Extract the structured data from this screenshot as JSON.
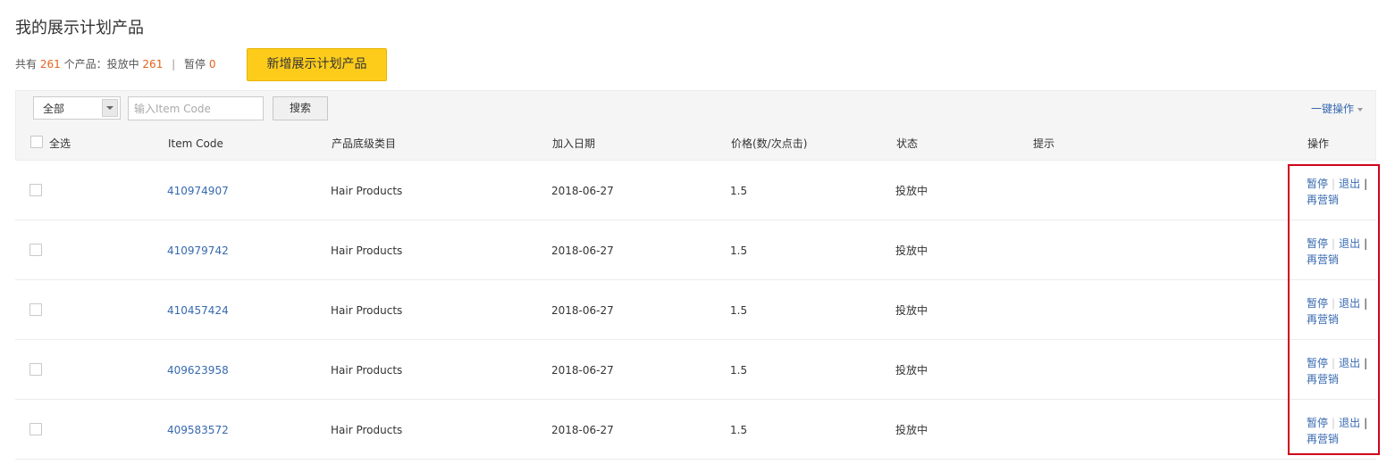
{
  "page": {
    "title": "我的展示计划产品"
  },
  "summary": {
    "prefix": "共有",
    "total": "261",
    "middle": "个产品：投放中",
    "active": "261",
    "separator": "|",
    "paused_label": "暂停",
    "paused": "0"
  },
  "add_button": {
    "label": "新增展示计划产品"
  },
  "toolbar": {
    "filter_value": "全部",
    "search_placeholder": "输入Item Code",
    "search_label": "搜索",
    "bulk_label": "一键操作"
  },
  "table": {
    "headers": {
      "select_all": "全选",
      "item_code": "Item Code",
      "category": "产品底级类目",
      "date": "加入日期",
      "price": "价格(数/次点击)",
      "status": "状态",
      "hint": "提示",
      "action": "操作"
    },
    "actions": {
      "pause": "暂停",
      "exit": "退出",
      "remarket": "再营销",
      "sep": "|"
    },
    "rows": [
      {
        "code": "410974907",
        "category": "Hair Products",
        "date": "2018-06-27",
        "price": "1.5",
        "status": "投放中",
        "hint": ""
      },
      {
        "code": "410979742",
        "category": "Hair Products",
        "date": "2018-06-27",
        "price": "1.5",
        "status": "投放中",
        "hint": ""
      },
      {
        "code": "410457424",
        "category": "Hair Products",
        "date": "2018-06-27",
        "price": "1.5",
        "status": "投放中",
        "hint": ""
      },
      {
        "code": "409623958",
        "category": "Hair Products",
        "date": "2018-06-27",
        "price": "1.5",
        "status": "投放中",
        "hint": ""
      },
      {
        "code": "409583572",
        "category": "Hair Products",
        "date": "2018-06-27",
        "price": "1.5",
        "status": "投放中",
        "hint": ""
      }
    ]
  },
  "colors": {
    "accent": "#3769b0",
    "highlight_number": "#e4621e",
    "primary_button": "#fdcc1b",
    "annotation_box": "#d0021b"
  }
}
